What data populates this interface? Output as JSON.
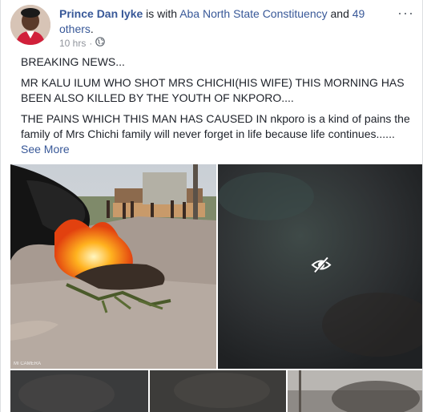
{
  "post": {
    "author": "Prince Dan Iyke",
    "with_text": " is with ",
    "location": "Aba North State Constituency",
    "and_text": " and ",
    "others": "49 others",
    "trailing": ".",
    "time": "10 hrs",
    "separator": "·",
    "privacy_icon": "globe-icon",
    "menu_label": "···"
  },
  "content": {
    "line1": "BREAKING NEWS...",
    "line2": "MR KALU ILUM WHO SHOT MRS CHICHI(HIS WIFE) THIS MORNING HAS BEEN ALSO KILLED BY THE YOUTH OF NKPORO....",
    "line3": "THE PAINS WHICH THIS MAN HAS CAUSED IN nkporo is a kind of pains the family of Mrs Chichi family will never forget in life because life continues......",
    "see_more": "See More"
  },
  "photos": {
    "watermark": "MI CAMERA",
    "hidden_icon": "eye-slash-icon"
  }
}
